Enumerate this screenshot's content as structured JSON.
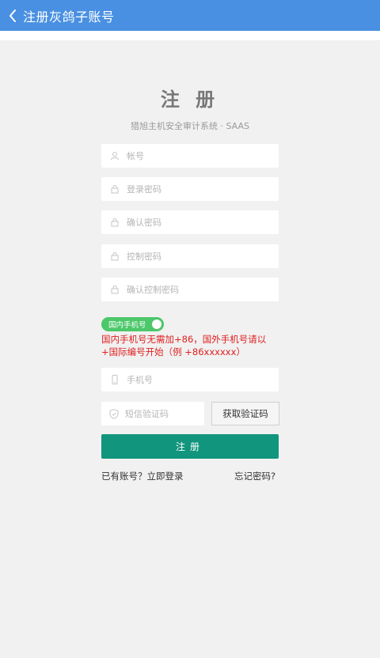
{
  "header": {
    "title": "注册灰鸽子账号",
    "back_icon": "chevron-left-icon"
  },
  "form": {
    "title": "注 册",
    "subtitle": "猎旭主机安全审计系统 · SAAS",
    "account_placeholder": "帐号",
    "password_placeholder": "登录密码",
    "confirm_password_placeholder": "确认密码",
    "control_password_placeholder": "控制密码",
    "confirm_control_password_placeholder": "确认控制密码",
    "phone_toggle_label": "国内手机号",
    "phone_toggle_on": true,
    "phone_notice": "国内手机号无需加+86，国外手机号请以+国际编号开始（例 +86xxxxxx）",
    "phone_placeholder": "手机号",
    "sms_code_placeholder": "短信验证码",
    "get_code_label": "获取验证码",
    "submit_label": "注册",
    "have_account_link": "已有账号？立即登录",
    "forgot_password_link": "忘记密码?"
  },
  "colors": {
    "header_bg": "#4a90e2",
    "toggle_bg": "#4cc76a",
    "notice_text": "#e02020",
    "submit_bg": "#11957c"
  }
}
